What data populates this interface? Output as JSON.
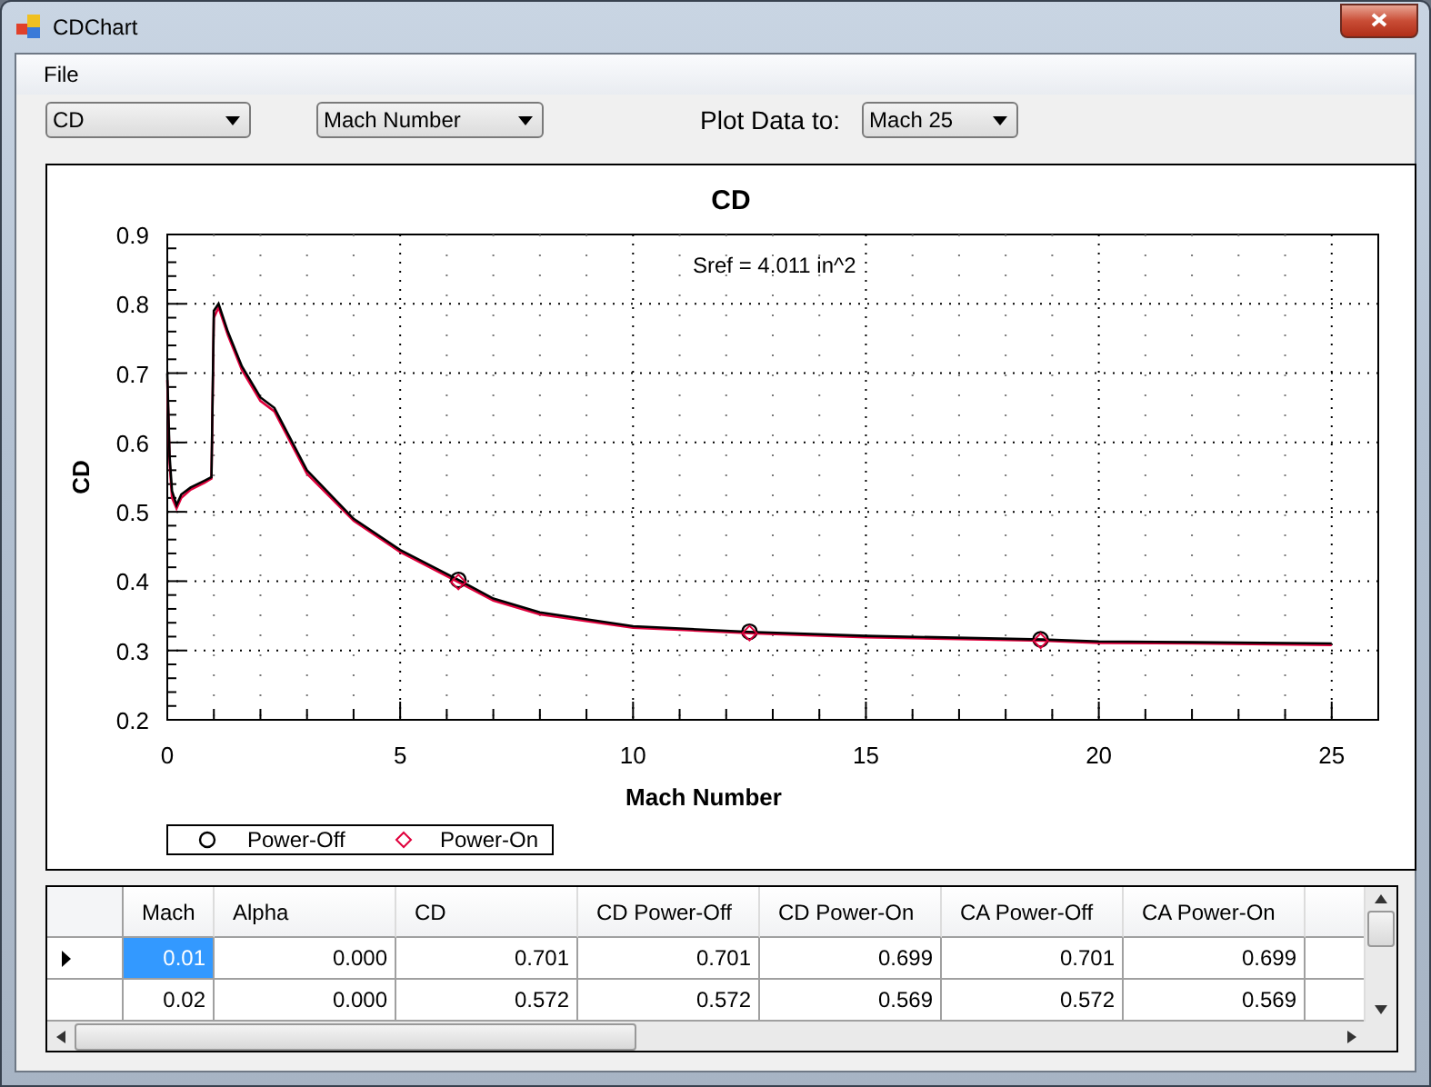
{
  "window": {
    "title": "CDChart"
  },
  "menu": [
    {
      "label": "File"
    }
  ],
  "toolbar": {
    "coefficient": {
      "value": "CD"
    },
    "x_axis": {
      "value": "Mach Number"
    },
    "plot_to_label": "Plot Data to:",
    "plot_to": {
      "value": "Mach 25"
    }
  },
  "chart": {
    "annotation": "Sref = 4.011 in^2",
    "chart_data": {
      "type": "line",
      "title": "CD",
      "xlabel": "Mach Number",
      "ylabel": "CD",
      "xlim": [
        0,
        26
      ],
      "ylim": [
        0.2,
        0.9
      ],
      "xticks": [
        0,
        5,
        10,
        15,
        20,
        25
      ],
      "yticks": [
        0.2,
        0.3,
        0.4,
        0.5,
        0.6,
        0.7,
        0.8,
        0.9
      ],
      "grid": true,
      "legend": "lower left",
      "x": [
        0,
        0.05,
        0.1,
        0.2,
        0.3,
        0.5,
        0.8,
        0.95,
        1.0,
        1.1,
        1.3,
        1.6,
        2,
        2.3,
        3,
        4,
        5,
        6.3,
        7,
        8,
        10,
        12.5,
        15,
        18.8,
        20,
        22,
        25
      ],
      "series": [
        {
          "name": "Power-Off",
          "color": "#000000",
          "values": [
            0.7,
            0.58,
            0.53,
            0.51,
            0.525,
            0.535,
            0.545,
            0.55,
            0.79,
            0.8,
            0.76,
            0.71,
            0.665,
            0.65,
            0.56,
            0.49,
            0.445,
            0.4,
            0.375,
            0.355,
            0.335,
            0.327,
            0.321,
            0.316,
            0.313,
            0.312,
            0.31
          ]
        },
        {
          "name": "Power-On",
          "color": "#e0003c",
          "values": [
            0.69,
            0.57,
            0.52,
            0.505,
            0.52,
            0.532,
            0.542,
            0.548,
            0.78,
            0.795,
            0.755,
            0.705,
            0.66,
            0.645,
            0.555,
            0.487,
            0.442,
            0.397,
            0.372,
            0.352,
            0.333,
            0.325,
            0.319,
            0.314,
            0.311,
            0.31,
            0.308
          ]
        }
      ]
    }
  },
  "table": {
    "columns": [
      "Mach",
      "Alpha",
      "CD",
      "CD Power-Off",
      "CD Power-On",
      "CA Power-Off",
      "CA Power-On"
    ],
    "rows": [
      {
        "current": true,
        "cells": [
          "0.01",
          "0.000",
          "0.701",
          "0.701",
          "0.699",
          "0.701",
          "0.699"
        ]
      },
      {
        "current": false,
        "cells": [
          "0.02",
          "0.000",
          "0.572",
          "0.572",
          "0.569",
          "0.572",
          "0.569"
        ]
      }
    ]
  }
}
